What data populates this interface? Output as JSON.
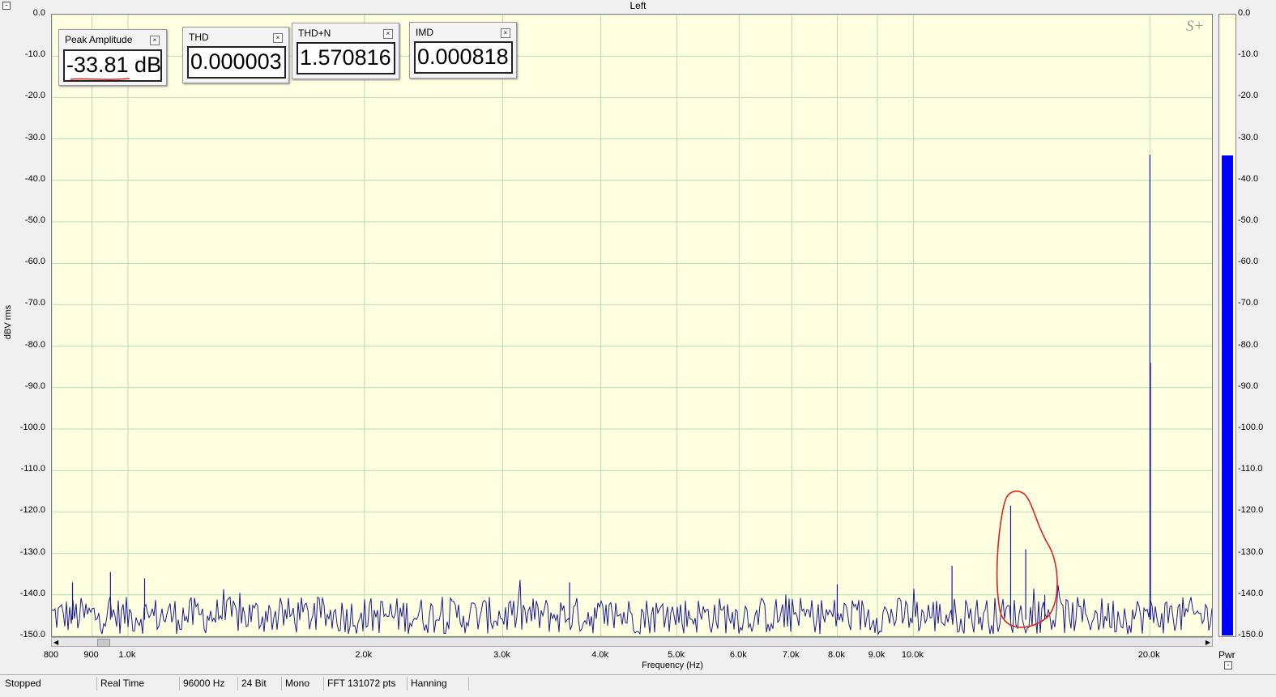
{
  "title": "Left",
  "collapse_symbol": "-",
  "watermark": "S+",
  "y_axis": {
    "label": "dBV rms",
    "ticks": [
      "0.0",
      "-10.0",
      "-20.0",
      "-30.0",
      "-40.0",
      "-50.0",
      "-60.0",
      "-70.0",
      "-80.0",
      "-90.0",
      "-100.0",
      "-110.0",
      "-120.0",
      "-130.0",
      "-140.0",
      "-150.0"
    ]
  },
  "x_axis": {
    "label": "Frequency (Hz)",
    "ticks": [
      "800",
      "900",
      "1.0k",
      "2.0k",
      "3.0k",
      "4.0k",
      "5.0k",
      "6.0k",
      "7.0k",
      "8.0k",
      "9.0k",
      "10.0k",
      "20.0k"
    ]
  },
  "meters": [
    {
      "title": "Peak Amplitude",
      "value": "-33.81 dB"
    },
    {
      "title": "THD",
      "value": "0.000003"
    },
    {
      "title": "THD+N",
      "value": "1.570816"
    },
    {
      "title": "IMD",
      "value": "0.000818"
    }
  ],
  "pwr_meter": {
    "label": "Pwr",
    "level_db": -33.81,
    "color": "#0000ff"
  },
  "status_bar": [
    "Stopped",
    "Real Time",
    "96000 Hz",
    "24 Bit",
    "Mono",
    "FFT 131072 pts",
    "Hanning"
  ],
  "colors": {
    "plot_bg": "#ffffe1",
    "grid": "#b4e0b4",
    "trace": "#1a1a9c",
    "annotation": "#e02020"
  },
  "chart_data": {
    "type": "line",
    "xlabel": "Frequency (Hz)",
    "ylabel": "dBV rms",
    "x_scale": "log",
    "xlim": [
      800,
      24000
    ],
    "ylim": [
      -150,
      0
    ],
    "grid": true,
    "noise_floor_db": -145,
    "peaks": [
      {
        "x": 850,
        "y": -137
      },
      {
        "x": 950,
        "y": -134.5
      },
      {
        "x": 1050,
        "y": -136
      },
      {
        "x": 3650,
        "y": -137
      },
      {
        "x": 8000,
        "y": -137.5
      },
      {
        "x": 11200,
        "y": -133
      },
      {
        "x": 13300,
        "y": -118.5
      },
      {
        "x": 13900,
        "y": -129
      },
      {
        "x": 14700,
        "y": -140
      },
      {
        "x": 20010,
        "y": -33.81
      },
      {
        "x": 20040,
        "y": -84
      }
    ]
  }
}
